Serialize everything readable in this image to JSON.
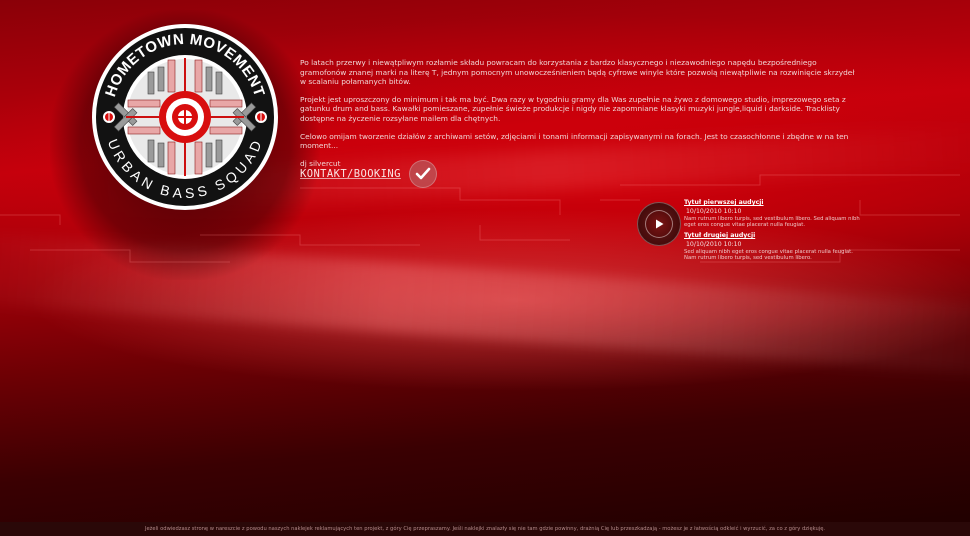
{
  "logo": {
    "top_text": "HOMETOWN MOVEMENT",
    "bottom_text": "URBAN BASS SQUAD"
  },
  "intro": {
    "paragraph_1": "Po latach przerwy i niewątpliwym rozłamie składu powracam do korzystania z bardzo klasycznego i niezawodniego napędu bezpośredniego gramofonów znanej marki na literę T, jednym pomocnym unowocześnieniem będą cyfrowe winyle które pozwolą niewątpliwie na rozwinięcie skrzydeł w scalaniu połamanych bitów.",
    "paragraph_2": "Projekt jest uproszczony do minimum i tak ma być. Dwa razy w tygodniu gramy dla Was zupełnie na żywo z domowego studio, imprezowego seta z gatunku drum and bass. Kawałki pomieszane, zupełnie świeże produkcje i nigdy nie zapomniane klasyki muzyki jungle,liquid i darkside. Tracklisty dostępne na życzenie rozsyłane mailem dla chętnych.",
    "paragraph_3": "Celowo omijam tworzenie działów z archiwami setów, zdjęciami i tonami informacji zapisywanymi na forach. Jest to czasochłonne i zbędne w na ten moment...",
    "signature": "dj silvercut"
  },
  "contact": {
    "label": "KONTAKT/BOOKING"
  },
  "auditions": [
    {
      "title": "Tytuł pierwszej audycji",
      "date": "10/10/2010 10:10",
      "description": "Nam rutrum libero turpis, sed vestibulum libero. Sed aliquam nibh eget eros congue vitae placerat nulla feugiat."
    },
    {
      "title": "Tytuł drugiej audycji",
      "date": "10/10/2010 10:10",
      "description": "Sed aliquam nibh eget eros congue vitae placerat nulla feugiat. Nam rutrum libero turpis, sed vestibulum libero."
    }
  ],
  "footer": {
    "text": "Jeżeli odwiedzasz stronę w nareszcie z powodu naszych naklejek reklamujących ten projekt, z góry Cię przepraszamy. Jeśli naklejki znalazły się nie tam gdzie powinny, drażnią Cię lub przeszkadzają - możesz je z łatwością odkleić i wyrzucić, za co z góry dziękuję."
  },
  "colors": {
    "accent_red": "#c4000c",
    "dark_red": "#3a0002",
    "text_light": "#f1d6d6"
  },
  "icons": {
    "logo": "crosshair-vinyl-logo",
    "contact": "checkmark-icon",
    "player": "play-icon"
  }
}
